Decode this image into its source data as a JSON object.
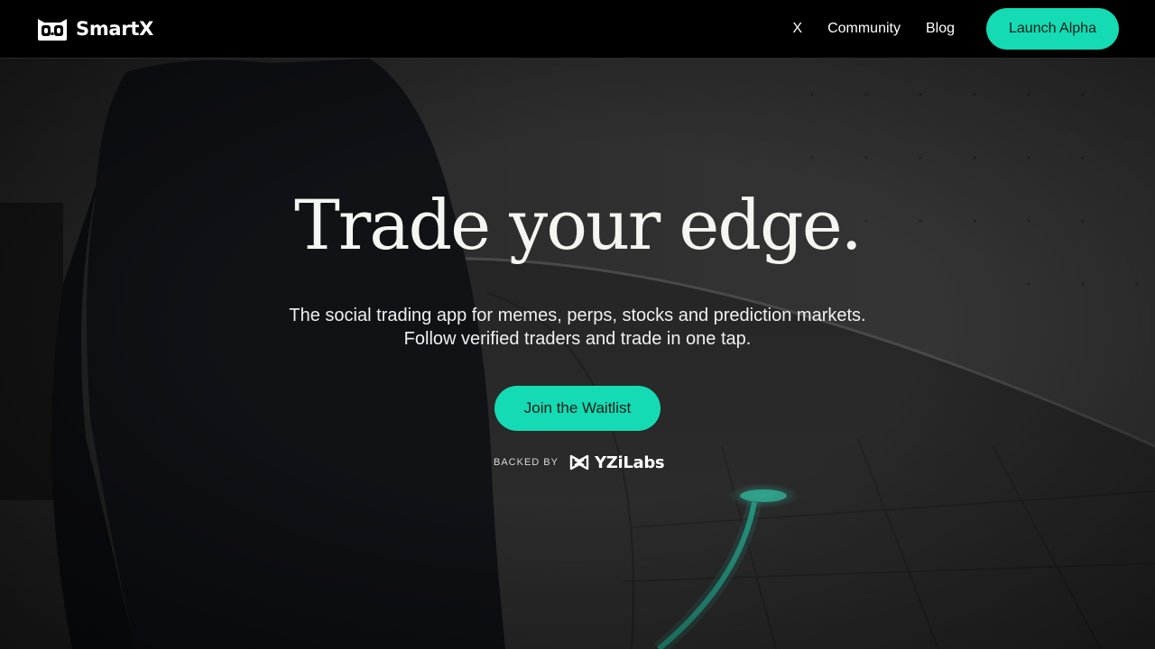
{
  "brand": {
    "name": "SmartX",
    "logo_icon": "owl-face-icon"
  },
  "nav": {
    "links": [
      {
        "label": "X"
      },
      {
        "label": "Community"
      },
      {
        "label": "Blog"
      }
    ],
    "cta_label": "Launch Alpha"
  },
  "hero": {
    "headline": "Trade your edge.",
    "subtitle_line1": "The social trading app for memes, perps, stocks and prediction markets.",
    "subtitle_line2": "Follow verified traders and trade in one tap.",
    "cta_label": "Join the Waitlist",
    "backed_by_label": "BACKED BY",
    "backer_name": "YZiLabs",
    "backer_logo_icon": "yzi-labs-logo-icon"
  },
  "colors": {
    "accent": "#14dbb4",
    "nav_background": "#000000",
    "text": "#ffffff"
  }
}
